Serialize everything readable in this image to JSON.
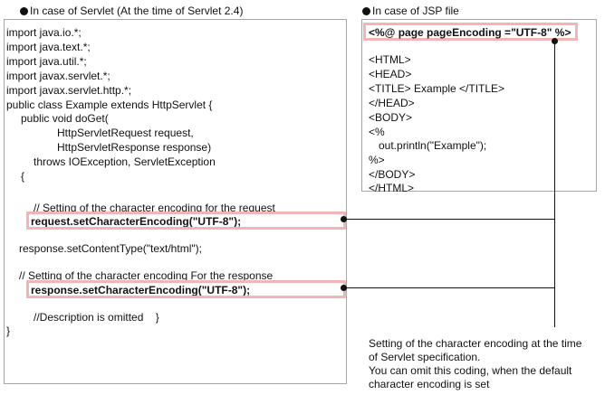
{
  "servlet": {
    "heading": "In case of Servlet (At the time of Servlet 2.4)",
    "lines": [
      "import java.io.*;",
      "import java.text.*;",
      "import java.util.*;",
      "import javax.servlet.*;",
      "import javax.servlet.http.*;",
      "public class Example extends HttpServlet {",
      "public void doGet(",
      "HttpServletRequest request,",
      "HttpServletResponse response)",
      "throws IOException, ServletException",
      "{",
      "// Setting of the character encoding for the request",
      "request.setCharacterEncoding(\"UTF-8\");",
      "response.setContentType(\"text/html\");",
      "// Setting of the character encoding For the response",
      "response.setCharacterEncoding(\"UTF-8\");",
      "//Description is omitted    }",
      "}"
    ]
  },
  "jsp": {
    "heading": "In case of JSP file",
    "directive": "<%@ page pageEncoding =\"UTF-8\" %>",
    "lines": [
      "<HTML>",
      "<HEAD>",
      "<TITLE> Example </TITLE>",
      "</HEAD>",
      "<BODY>",
      "<%",
      "out.println(\"Example\");",
      "%>",
      "</BODY>",
      "</HTML>"
    ]
  },
  "note": {
    "lines": [
      "Setting of the character encoding at the time",
      "of Servlet specification.",
      "You can omit this coding, when the default",
      "character encoding is set"
    ]
  },
  "colors": {
    "highlight": "#f4b4b4",
    "box_border": "#a6a6a6",
    "text": "#111111"
  }
}
